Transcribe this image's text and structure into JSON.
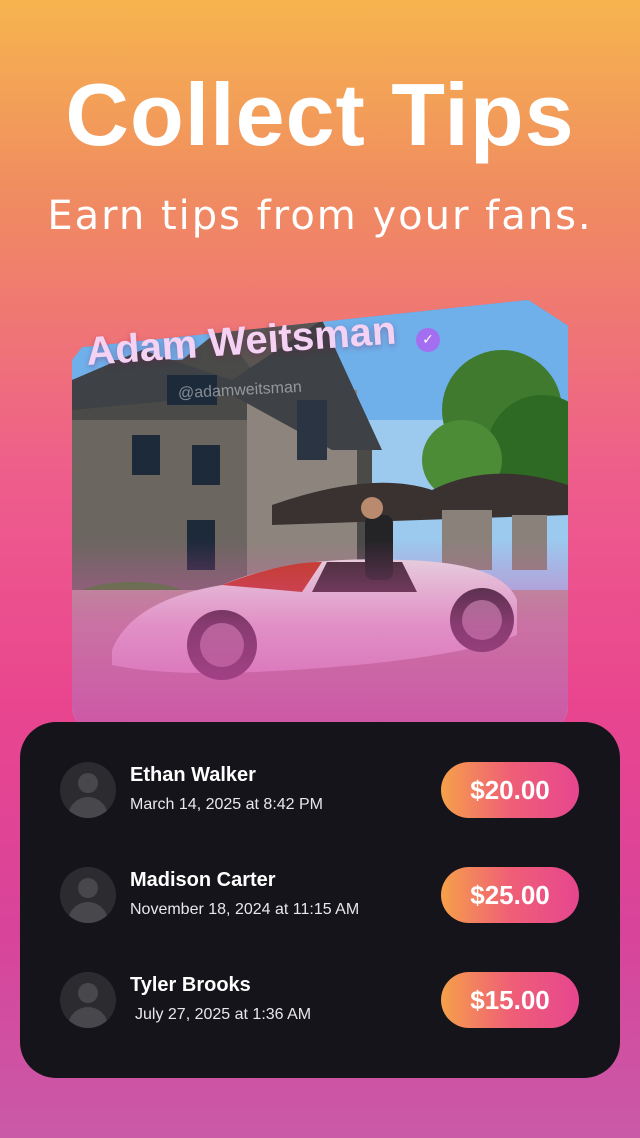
{
  "hero": {
    "title": "Collect Tips",
    "subtitle": "Earn tips from your fans."
  },
  "profile": {
    "name": "Adam Weitsman",
    "handle": "@adamweitsman",
    "verified": true
  },
  "tips": [
    {
      "name": "Ethan Walker",
      "date": "March 14, 2025 at 8:42 PM",
      "amount": "$20.00"
    },
    {
      "name": "Madison Carter",
      "date": "November 18, 2024 at 11:15 AM",
      "amount": "$25.00"
    },
    {
      "name": "Tyler Brooks",
      "date": "July 27, 2025 at 1:36 AM",
      "amount": "$15.00"
    }
  ],
  "colors": {
    "accent_gradient_start": "#f6a04a",
    "accent_gradient_end": "#e6468f",
    "panel_bg": "#14141a",
    "verified_badge": "#a46ef0"
  }
}
